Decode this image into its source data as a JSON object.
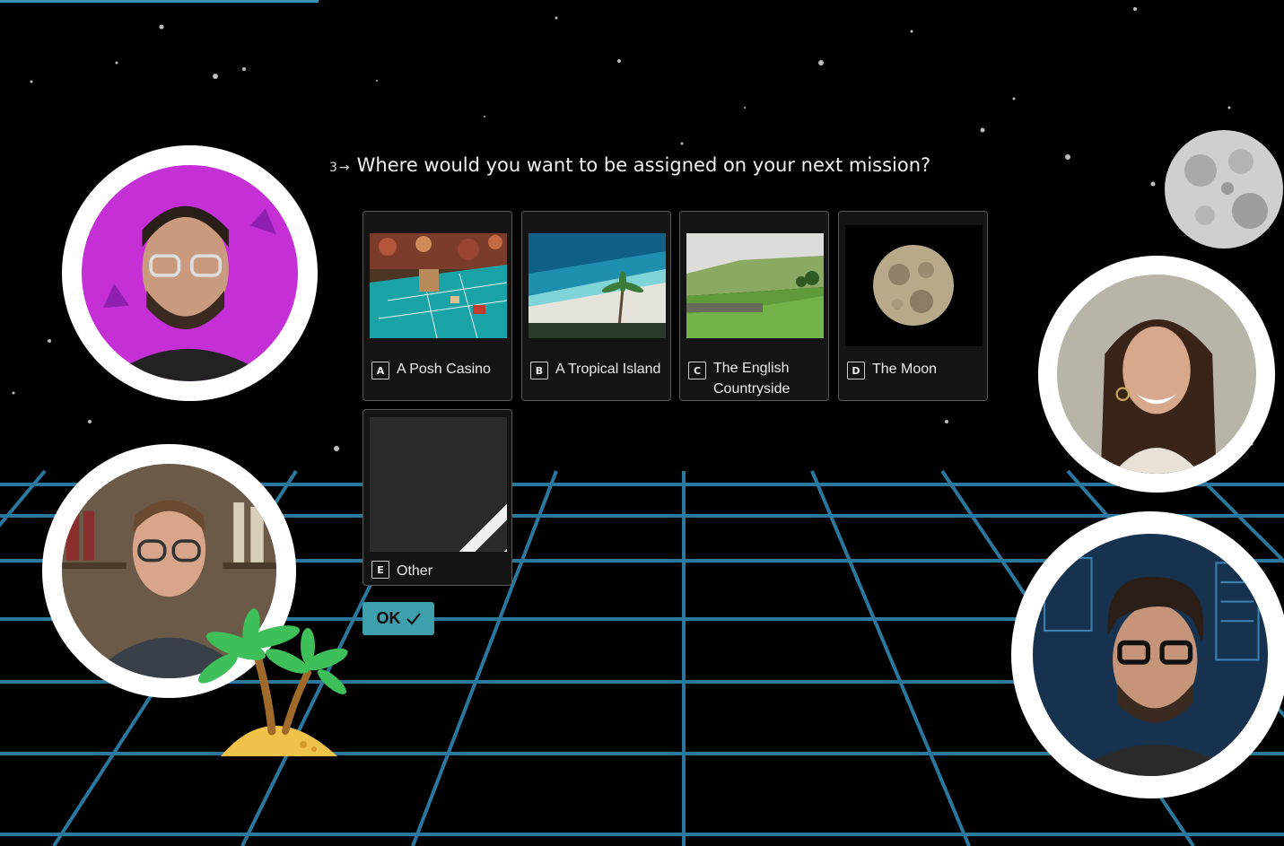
{
  "question": {
    "number": "3",
    "arrow": "→",
    "text": "Where would you want to be assigned on your next mission?"
  },
  "options": [
    {
      "key": "A",
      "label": "A Posh Casino",
      "image": "casino-image"
    },
    {
      "key": "B",
      "label": "A Tropical Island",
      "image": "tropical-island-image"
    },
    {
      "key": "C",
      "label": "The English Countryside",
      "image": "countryside-image"
    },
    {
      "key": "D",
      "label": "The Moon",
      "image": "moon-image"
    },
    {
      "key": "E",
      "label": "Other",
      "icon": "pencil-icon"
    }
  ],
  "ok_button": {
    "label": "OK",
    "icon": "checkmark-icon"
  },
  "participants": [
    {
      "name": "participant-1",
      "background": "#c52fd6"
    },
    {
      "name": "participant-2",
      "background": "#6b5a48"
    },
    {
      "name": "participant-3",
      "background": "#b9b4a8"
    },
    {
      "name": "participant-4",
      "background": "#16324f"
    }
  ],
  "decorations": [
    "stars",
    "neon-grid",
    "moon-icon",
    "palm-island-icon"
  ],
  "colors": {
    "background": "#000000",
    "grid": "#2e7fa8",
    "accent": "#3e9fad",
    "card_border": "#5a5a5a"
  }
}
